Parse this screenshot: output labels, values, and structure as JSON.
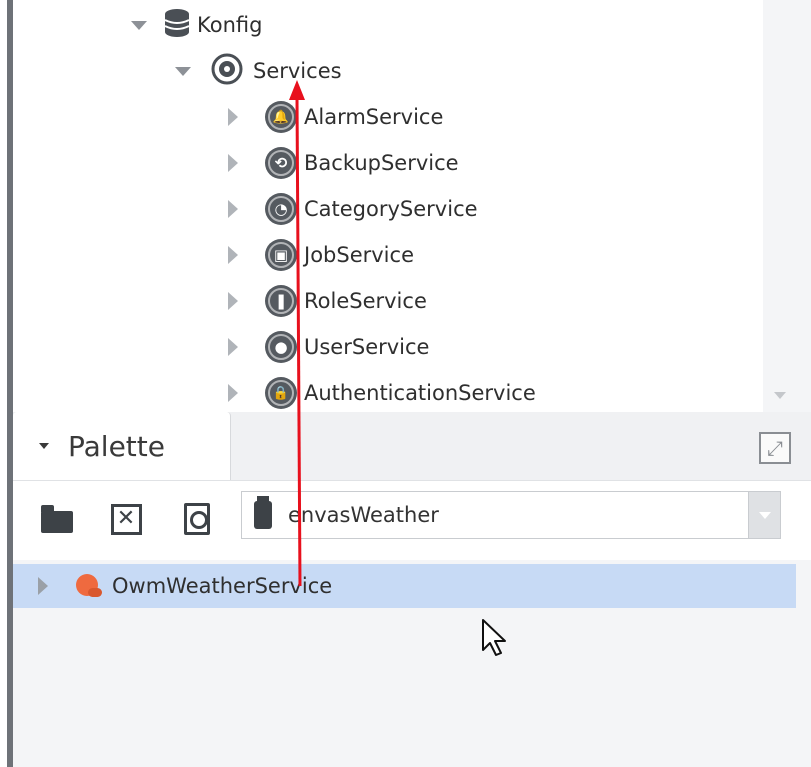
{
  "tree": {
    "root": {
      "label": "Konfig",
      "icon": "database-icon"
    },
    "services": {
      "label": "Services",
      "icon": "services-icon"
    },
    "items": [
      {
        "label": "AlarmService",
        "icon": "bell-icon",
        "glyph": "🔔"
      },
      {
        "label": "BackupService",
        "icon": "backup-clock-icon",
        "glyph": "⟲"
      },
      {
        "label": "CategoryService",
        "icon": "category-icon",
        "glyph": "◔"
      },
      {
        "label": "JobService",
        "icon": "job-icon",
        "glyph": "▣"
      },
      {
        "label": "RoleService",
        "icon": "role-icon",
        "glyph": "❚"
      },
      {
        "label": "UserService",
        "icon": "user-icon",
        "glyph": "●"
      },
      {
        "label": "AuthenticationService",
        "icon": "lock-icon",
        "glyph": "🔒"
      }
    ]
  },
  "palette": {
    "title": "Palette",
    "module": "envasWeather",
    "maximize_glyph": "⤢",
    "close_glyph": "✕",
    "items": [
      {
        "label": "OwmWeatherService",
        "icon": "weather-icon"
      }
    ]
  },
  "colors": {
    "selection": "#c7daf5",
    "annotation_arrow": "#e8101d",
    "weather_icon": "#ef6a3f"
  }
}
